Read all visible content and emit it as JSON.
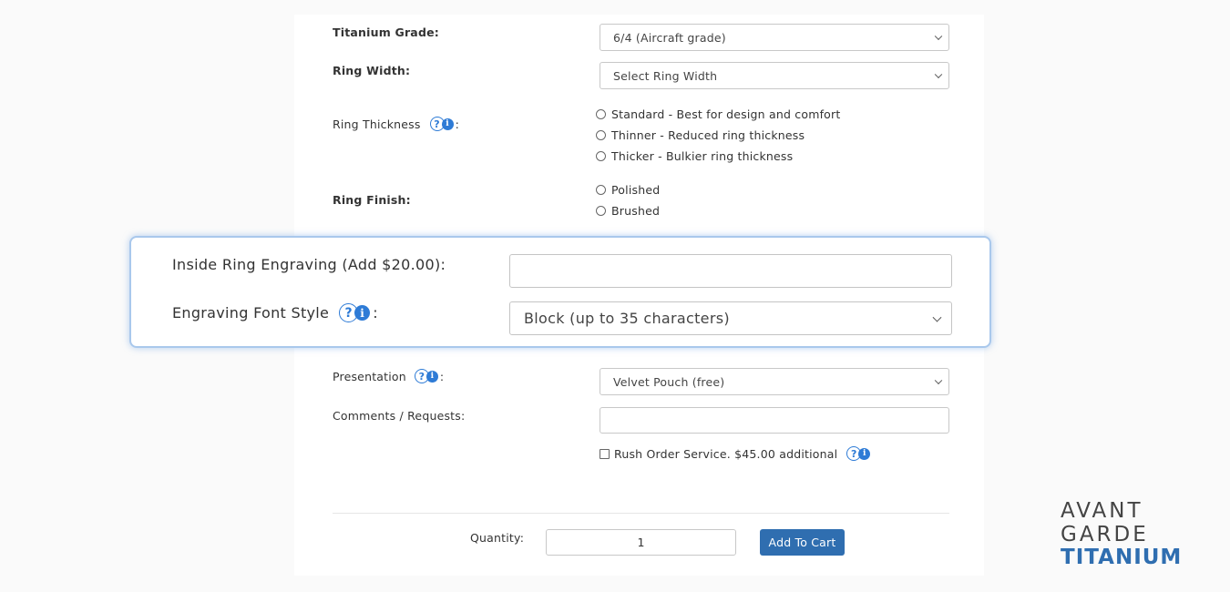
{
  "form": {
    "titanium_grade": {
      "label": "Titanium Grade:",
      "value": "6/4 (Aircraft grade)"
    },
    "ring_width": {
      "label": "Ring Width:",
      "value": "Select Ring Width"
    },
    "ring_thickness": {
      "label": "Ring Thickness",
      "suffix": ":",
      "options": [
        "Standard - Best for design and comfort",
        "Thinner - Reduced ring thickness",
        "Thicker - Bulkier ring thickness"
      ]
    },
    "ring_finish": {
      "label": "Ring Finish:",
      "options": [
        "Polished",
        "Brushed"
      ]
    },
    "presentation": {
      "label": "Presentation",
      "suffix": ":",
      "value": "Velvet Pouch (free)"
    },
    "comments": {
      "label": "Comments / Requests:",
      "value": ""
    },
    "rush_order": {
      "label": "Rush Order Service. $45.00 additional"
    },
    "quantity": {
      "label": "Quantity:",
      "value": "1"
    },
    "add_to_cart": "Add To Cart"
  },
  "zoom": {
    "engraving": {
      "label": "Inside Ring Engraving (Add $20.00):",
      "value": ""
    },
    "font_style": {
      "label": "Engraving Font Style",
      "suffix": ":",
      "value": "Block (up to 35 characters)"
    }
  },
  "icons": {
    "question": "?",
    "info": "i"
  },
  "logo": {
    "line1": "AVANT",
    "line2": "GARDE",
    "line3": "TITANIUM"
  },
  "colors": {
    "accent": "#2e7bd6",
    "button": "#2f6eb0",
    "highlight_border": "#a9c8ec"
  }
}
